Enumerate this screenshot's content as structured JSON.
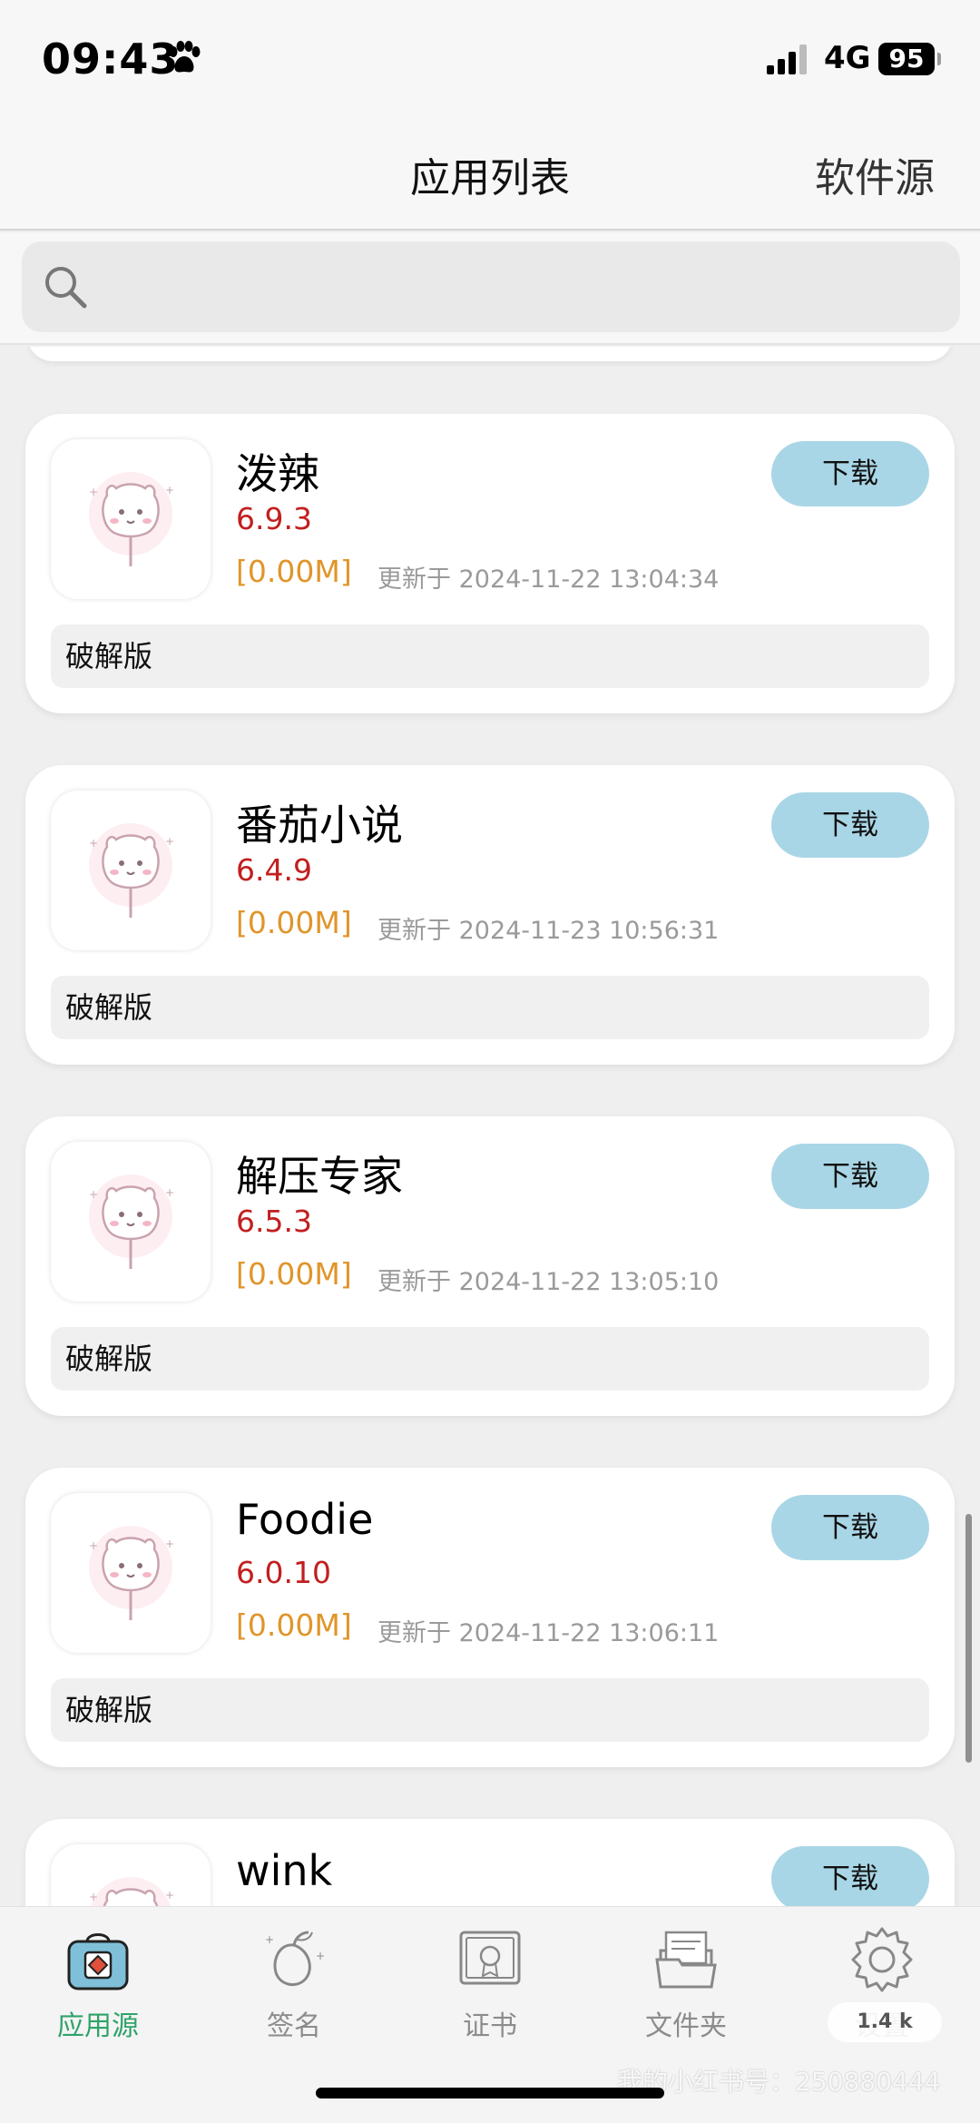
{
  "status_bar": {
    "time": "09:43",
    "network": "4G",
    "battery": "95"
  },
  "nav": {
    "title": "应用列表",
    "right_link": "软件源"
  },
  "search": {
    "placeholder": ""
  },
  "apps": [
    {
      "name": "泼辣",
      "version": "6.9.3",
      "size": "[0.00M]",
      "updated": "更新于 2024-11-22 13:04:34",
      "tag": "破解版",
      "download_label": "下载"
    },
    {
      "name": "番茄小说",
      "version": "6.4.9",
      "size": "[0.00M]",
      "updated": "更新于 2024-11-23 10:56:31",
      "tag": "破解版",
      "download_label": "下载"
    },
    {
      "name": "解压专家",
      "version": "6.5.3",
      "size": "[0.00M]",
      "updated": "更新于 2024-11-22 13:05:10",
      "tag": "破解版",
      "download_label": "下载"
    },
    {
      "name": "Foodie",
      "version": "6.0.10",
      "size": "[0.00M]",
      "updated": "更新于 2024-11-22 13:06:11",
      "tag": "破解版",
      "download_label": "下载"
    },
    {
      "name": "wink",
      "download_label": "下载"
    }
  ],
  "tabs": [
    {
      "label": "应用源",
      "icon": "app-source-icon",
      "active": true
    },
    {
      "label": "签名",
      "icon": "mango-icon",
      "active": false
    },
    {
      "label": "证书",
      "icon": "certificate-icon",
      "active": false
    },
    {
      "label": "文件夹",
      "icon": "folder-icon",
      "active": false
    },
    {
      "label": "设置",
      "icon": "gear-icon",
      "active": false
    }
  ],
  "tab_badge": "1.4 k",
  "watermark": "我的小红书号：250880444",
  "colors": {
    "accent": "#2fa36a",
    "download_button": "#a9d6e6",
    "version": "#c21f1f",
    "size": "#e0952a"
  }
}
